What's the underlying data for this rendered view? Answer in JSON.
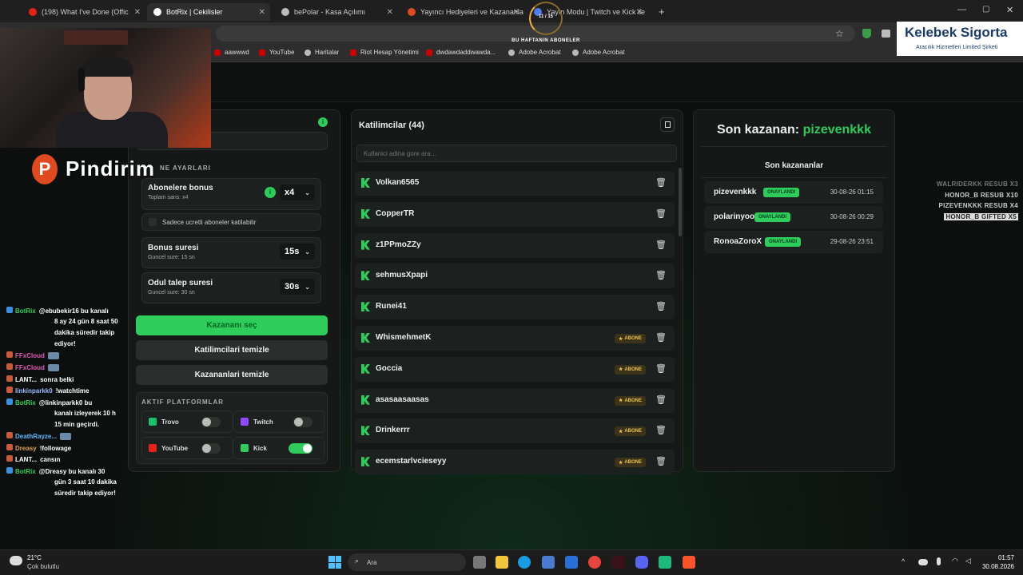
{
  "browser": {
    "tabs": [
      {
        "label": "(198) What I've Done (Offic",
        "icon": "youtube-icon",
        "color": "#e62117"
      },
      {
        "label": "BotRix | Cekilisler",
        "icon": "botrix-icon",
        "color": "#ffffff"
      },
      {
        "label": "bePolar - Kasa Açılımı",
        "icon": "globe-icon",
        "color": "#bbbbbb"
      },
      {
        "label": "Yayıncı Hediyeleri ve Kazananla",
        "icon": "p-icon",
        "color": "#e04a1f"
      },
      {
        "label": "Yayın Modu | Twitch ve Kick ile",
        "icon": "diamond-icon",
        "color": "#4c7cf0"
      }
    ],
    "bookmarks": [
      "aawwwd",
      "YouTube",
      "Haritalar",
      "Riot Hesap Yönetimi",
      "dwdawdaddwawda...",
      "Adobe Acrobat",
      "Adobe Acrobat"
    ]
  },
  "overlay": {
    "pindirim_logo_letter": "P",
    "pindirim_text": "Pindirim",
    "sponsor_title": "Kelebek Sigorta",
    "sponsor_sub": "Aracılık Hizmetleri Limited Şirketi",
    "goal_count": "11 / 15",
    "goal_label": "BU HAFTANIN ABONELER",
    "recent_events": [
      "WALRIDERKK RESUB X3",
      "HONOR_B RESUB X10",
      "PIZEVENKKK RESUB X4",
      "HONOR_B GIFTED X5"
    ]
  },
  "settings": {
    "section_title": "NE AYARLARI",
    "bonus_title": "Abonelere bonus",
    "bonus_sub": "Toplam sans: x4",
    "bonus_value": "x4",
    "only_paid_label": "Sadece ucretli aboneler katilabilir",
    "bonus_time_title": "Bonus suresi",
    "bonus_time_sub": "Guncel sure: 15 sn",
    "bonus_time_value": "15s",
    "claim_title": "Odul talep suresi",
    "claim_sub": "Guncel sure: 30 sn",
    "claim_value": "30s",
    "pick_winner": "Kazananı seç",
    "clear_participants": "Katilimcilari temizle",
    "clear_winners": "Kazananlari temizle",
    "platforms_title": "AKTIF PLATFORMLAR",
    "platforms": [
      {
        "name": "Trovo",
        "on": false,
        "color": "#1bbf6a"
      },
      {
        "name": "Twitch",
        "on": false,
        "color": "#9146ff"
      },
      {
        "name": "YouTube",
        "on": false,
        "color": "#e62117"
      },
      {
        "name": "Kick",
        "on": true,
        "color": "#2ecc5b"
      }
    ]
  },
  "participants": {
    "title": "Katilimcilar (44)",
    "search_placeholder": "Kullanici adina gore ara...",
    "badge_label": "ABONE",
    "list": [
      {
        "name": "Volkan6565",
        "sub": false
      },
      {
        "name": "CopperTR",
        "sub": false
      },
      {
        "name": "z1PPmoZZy",
        "sub": false
      },
      {
        "name": "sehmusXpapi",
        "sub": false
      },
      {
        "name": "Runei41",
        "sub": false
      },
      {
        "name": "WhismehmetK",
        "sub": true
      },
      {
        "name": "Goccia",
        "sub": true
      },
      {
        "name": "asasaasaasas",
        "sub": true
      },
      {
        "name": "Drinkerrr",
        "sub": true
      },
      {
        "name": "ecemstarlvcieseyy",
        "sub": true
      }
    ]
  },
  "winners": {
    "last_label": "Son kazanan:",
    "last_name": "pizevenkkk",
    "history_title": "Son kazananlar",
    "status_label": "ONAYLANDI",
    "list": [
      {
        "name": "pizevenkkk",
        "date": "30-08-26 01:15"
      },
      {
        "name": "polarinyoo",
        "date": "30-08-26 00:29"
      },
      {
        "name": "RonoaZoroX",
        "date": "29-08-26 23:51"
      }
    ]
  },
  "chat": [
    {
      "user": "BotRix",
      "color": "#2ecc5b",
      "msg": "@ebubekir16 bu kanalı"
    },
    {
      "user": "",
      "color": "#ffffff",
      "msg": "8 ay 24 gün 8 saat 50"
    },
    {
      "user": "",
      "color": "#ffffff",
      "msg": "dakika süredir takip"
    },
    {
      "user": "",
      "color": "#ffffff",
      "msg": "ediyor!"
    },
    {
      "user": "FFxCloud",
      "color": "#e05ab8",
      "msg": ""
    },
    {
      "user": "FFxCloud",
      "color": "#e05ab8",
      "msg": ""
    },
    {
      "user": "LANT...",
      "color": "#ffffff",
      "msg": "sonra belki"
    },
    {
      "user": "linkinparkk0",
      "color": "#9ab8ff",
      "msg": "!watchtime"
    },
    {
      "user": "BotRix",
      "color": "#2ecc5b",
      "msg": "@linkinparkk0 bu"
    },
    {
      "user": "",
      "color": "#ffffff",
      "msg": "kanalı izleyerek 10 h"
    },
    {
      "user": "",
      "color": "#ffffff",
      "msg": "15 min geçirdi."
    },
    {
      "user": "DeathRayze...",
      "color": "#5ab8ff",
      "msg": ""
    },
    {
      "user": "Dreasy",
      "color": "#e0a050",
      "msg": "!followage"
    },
    {
      "user": "LANT...",
      "color": "#ffffff",
      "msg": "cansın"
    },
    {
      "user": "BotRix",
      "color": "#2ecc5b",
      "msg": "@Dreasy bu kanalı 30"
    },
    {
      "user": "",
      "color": "#ffffff",
      "msg": "gün 3 saat 10 dakika"
    },
    {
      "user": "",
      "color": "#ffffff",
      "msg": "süredir takip ediyor!"
    }
  ],
  "taskbar": {
    "weather_temp": "21°C",
    "weather_desc": "Çok bulutlu",
    "search_label": "Ara",
    "time": "01:57",
    "date": "30.08.2026"
  }
}
